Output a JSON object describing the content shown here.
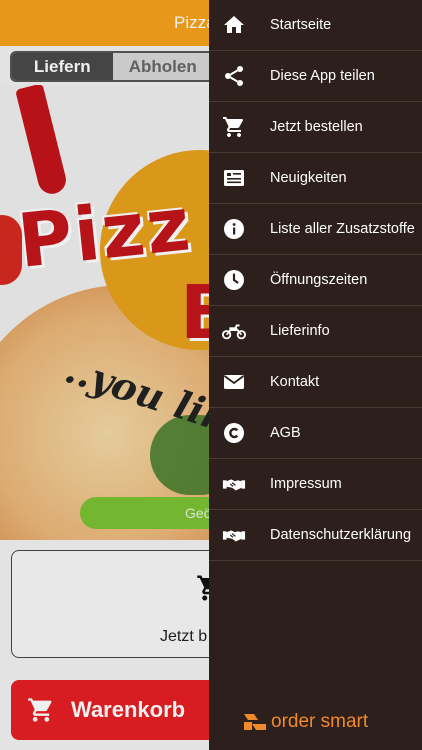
{
  "header": {
    "title": "Pizza"
  },
  "mode_toggle": {
    "delivery": "Liefern",
    "pickup": "Abholen"
  },
  "hero": {
    "slogan": "you like",
    "logo_text": "Pizz",
    "logo_text2": "B",
    "pill_text": "Geö"
  },
  "cart_box": {
    "label": "Jetzt b"
  },
  "cart_button": {
    "label": "Warenkorb"
  },
  "menu": {
    "items": [
      {
        "label": "Startseite",
        "icon": "home-icon"
      },
      {
        "label": "Diese App teilen",
        "icon": "share-icon"
      },
      {
        "label": "Jetzt bestellen",
        "icon": "cart-icon"
      },
      {
        "label": "Neuigkeiten",
        "icon": "news-icon"
      },
      {
        "label": "Liste aller Zusatzstoffe",
        "icon": "info-icon"
      },
      {
        "label": "Öffnungszeiten",
        "icon": "clock-icon"
      },
      {
        "label": "Lieferinfo",
        "icon": "motorbike-icon"
      },
      {
        "label": "Kontakt",
        "icon": "mail-icon"
      },
      {
        "label": "AGB",
        "icon": "copyright-icon"
      },
      {
        "label": "Impressum",
        "icon": "handshake-icon"
      },
      {
        "label": "Datenschutzerklärung",
        "icon": "handshake-icon"
      }
    ]
  },
  "brand": {
    "name": "order smart"
  },
  "colors": {
    "header": "#f7a21b",
    "drawer": "#2d1f1b",
    "accent_red": "#e51f25",
    "brand_orange": "#f0892b"
  }
}
